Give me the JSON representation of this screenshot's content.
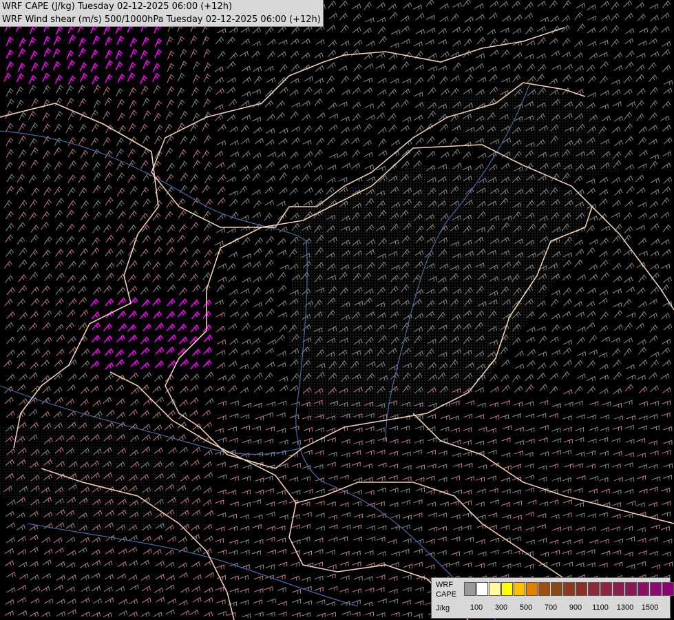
{
  "title": {
    "line1": "WRF CAPE (J/kg) Tuesday 02-12-2025 06:00 (+12h)",
    "line2": "WRF Wind shear (m/s) 500/1000hPa Tuesday 02-12-2025 06:00 (+12h)"
  },
  "legend": {
    "label_model": "WRF",
    "label_field": "CAPE",
    "label_unit": "J/kg",
    "colors": [
      "#9a9a9a",
      "#ffffff",
      "#fffaa0",
      "#ffff00",
      "#ffc000",
      "#e08000",
      "#a05010",
      "#8a4a18",
      "#8a3a20",
      "#8a3028",
      "#8a2a34",
      "#8a2440",
      "#8a1e4c",
      "#8a1858",
      "#8a1064",
      "#8a0a70",
      "#8a0078"
    ],
    "ticks": [
      "100",
      "300",
      "500",
      "700",
      "900",
      "1100",
      "1300",
      "1500"
    ]
  },
  "map": {
    "background": "#000000",
    "border_color": "#f0d0b0",
    "river_color": "#4a6aaa",
    "barb_colors": {
      "low": "#8c8c8c",
      "mid": "#c08080",
      "high": "#ff00ff"
    }
  }
}
